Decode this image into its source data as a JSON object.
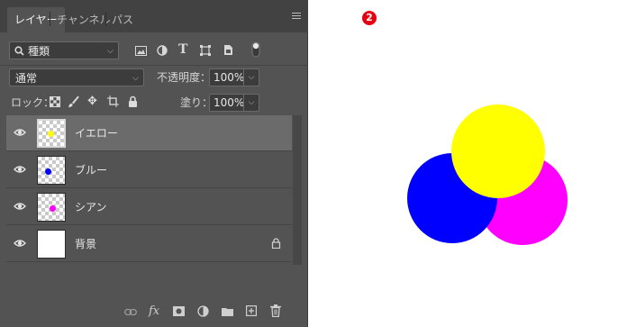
{
  "tabs": [
    "レイヤー",
    "チャンネル",
    "パス"
  ],
  "filter": {
    "label": "種類"
  },
  "blend": {
    "mode": "通常",
    "opacity_label": "不透明度：",
    "opacity_value": "100%"
  },
  "lock": {
    "label": "ロック：",
    "fill_label": "塗り：",
    "fill_value": "100%"
  },
  "layers": [
    {
      "name": "イエロー",
      "selected": true,
      "dot_color": "#ffff00"
    },
    {
      "name": "ブルー",
      "selected": false,
      "dot_color": "#0000ff"
    },
    {
      "name": "シアン",
      "selected": false,
      "dot_color": "#ff00ff"
    },
    {
      "name": "背景",
      "selected": false,
      "locked": true
    }
  ],
  "bottom_icons": [
    "link-icon",
    "fx-icon",
    "mask-icon",
    "adjustment-icon",
    "folder-icon",
    "new-layer-icon",
    "trash-icon"
  ],
  "bottom_fx_label": "fx",
  "badge": "2",
  "colors": {
    "yellow": "#ffff00",
    "blue": "#0000ff",
    "magenta": "#ff00ff",
    "badge": "#e60012"
  }
}
